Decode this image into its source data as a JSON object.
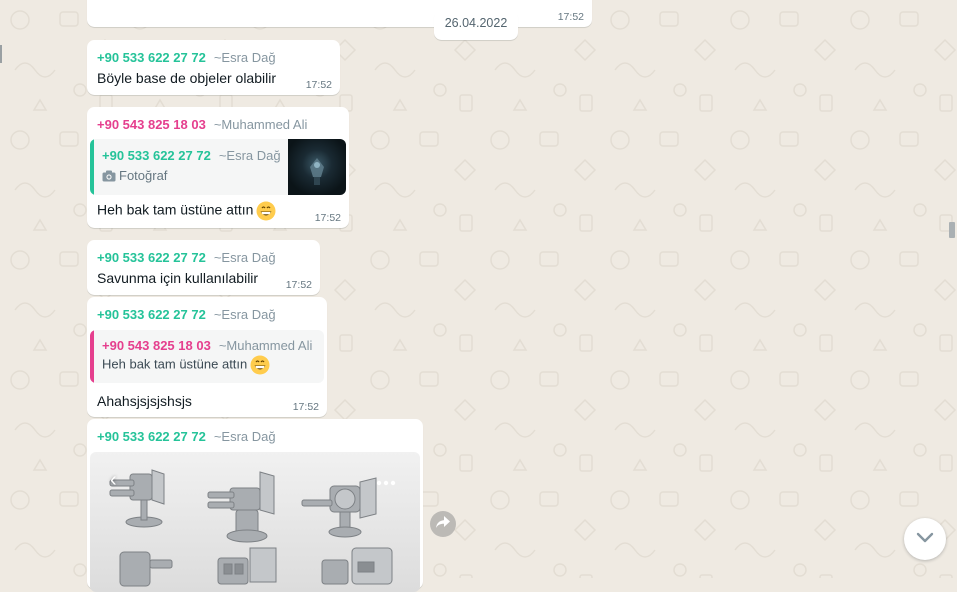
{
  "colors": {
    "wallpaper": "#efeae2",
    "bubble": "#ffffff",
    "sender_green": "#25c399",
    "sender_pink": "#e53f8e",
    "alias_gray": "#8696a0",
    "time_gray": "#667781"
  },
  "date_divider": "26.04.2022",
  "top_bubble_time": "17:52",
  "messages": [
    {
      "sender_phone": "+90 533 622 27 72",
      "sender_alias": "~Esra Dağ",
      "text": "Böyle base de objeler olabilir",
      "time": "17:52"
    },
    {
      "sender_phone": "+90 543 825 18 03",
      "sender_alias": "~Muhammed Ali",
      "quote": {
        "phone": "+90 533 622 27 72",
        "alias": "~Esra Dağ",
        "media_label": "Fotoğraf",
        "media_icon": "camera-icon"
      },
      "text": "Heh bak tam üstüne attın",
      "emoji": "grinning-face-icon",
      "time": "17:52"
    },
    {
      "sender_phone": "+90 533 622 27 72",
      "sender_alias": "~Esra Dağ",
      "text": "Savunma için kullanılabilir",
      "time": "17:52"
    },
    {
      "sender_phone": "+90 533 622 27 72",
      "sender_alias": "~Esra Dağ",
      "quote": {
        "phone": "+90 543 825 18 03",
        "alias": "~Muhammed Ali",
        "text": "Heh bak tam üstüne attın",
        "emoji": "grinning-face-icon"
      },
      "text": "Ahahsjsjsjshsjs",
      "time": "17:52"
    },
    {
      "sender_phone": "+90 533 622 27 72",
      "sender_alias": "~Esra Dağ",
      "image": "turret-models-image",
      "image_actions": [
        "chevron-left-icon",
        "more-options-icon"
      ]
    }
  ],
  "forward_button_icon": "forward-icon",
  "scroll_down_button_icon": "chevron-down-icon"
}
